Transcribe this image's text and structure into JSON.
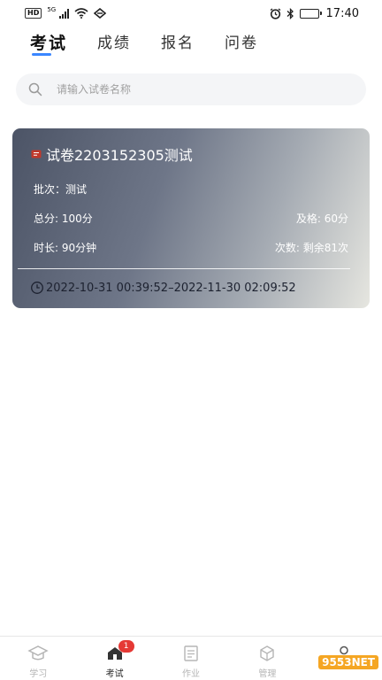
{
  "status": {
    "time": "17:40",
    "network": "5G",
    "hd": "HD"
  },
  "tabs": [
    {
      "label": "考试",
      "active": true
    },
    {
      "label": "成绩",
      "active": false
    },
    {
      "label": "报名",
      "active": false
    },
    {
      "label": "问卷",
      "active": false
    }
  ],
  "search": {
    "placeholder": "请输入试卷名称"
  },
  "card": {
    "title": "试卷2203152305测试",
    "batch": "批次：测试",
    "total_score": "总分: 100分",
    "pass_score": "及格: 60分",
    "duration": "时长: 90分钟",
    "attempts": "次数: 剩余81次",
    "time_range": "2022-10-31 00:39:52–2022-11-30 02:09:52"
  },
  "nav": [
    {
      "label": "学习",
      "icon": "graduation-cap-icon"
    },
    {
      "label": "考试",
      "icon": "exam-icon",
      "badge": "1",
      "active": true
    },
    {
      "label": "作业",
      "icon": "document-icon"
    },
    {
      "label": "管理",
      "icon": "cube-icon"
    },
    {
      "label": "",
      "icon": "person-icon"
    }
  ],
  "watermark": "9553NET",
  "colors": {
    "accent": "#3a86ff",
    "badge": "#e53935"
  }
}
